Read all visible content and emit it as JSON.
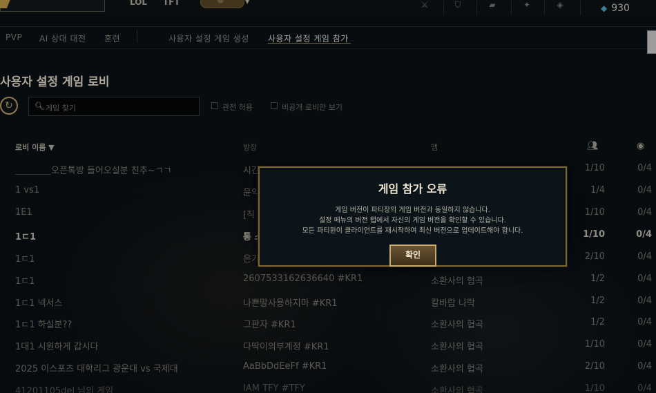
{
  "topbar": {
    "left_text_1": "LOL",
    "left_text_2": "TFT",
    "currency_value": "930"
  },
  "nav": {
    "pvp": "PVP",
    "ai": "AI 상대 대전",
    "training": "훈련",
    "custom_create": "사용자 설정 게임 생성",
    "custom_join": "사용자 설정 게임 참가"
  },
  "lobby": {
    "title": "사용자 설정 게임 로비",
    "search_placeholder": "게임 찾기",
    "allow_spectate": "관전 허용",
    "private_only": "비공개 로비만 보기"
  },
  "table": {
    "headers": {
      "lobby_name": "로비 이름 ▼",
      "owner": "방장",
      "map": "맵"
    },
    "rows": [
      {
        "name": "＿＿＿＿오픈톡방 들어오실분 친추~ㄱㄱ",
        "owner": "시간",
        "map": "",
        "players": "1/10",
        "spectators": "0/4"
      },
      {
        "name": "1 vs1",
        "owner": "윤익",
        "map": "",
        "players": "1/4",
        "spectators": "0/4"
      },
      {
        "name": "1E1",
        "owner": "[직",
        "map": "",
        "players": "1/10",
        "spectators": "0/4"
      },
      {
        "name": "1ㄷ1",
        "owner": "통 스",
        "map": "",
        "players": "1/10",
        "spectators": "0/4"
      },
      {
        "name": "1ㄷ1",
        "owner": "은가",
        "map": "",
        "players": "2/10",
        "spectators": "0/4"
      },
      {
        "name": "1ㄷ1",
        "owner": "2607533162636640 #KR1",
        "map": "소환사의 협곡",
        "players": "1/2",
        "spectators": "0/4"
      },
      {
        "name": "1ㄷ1 넥서스",
        "owner": "나쁜말사용하지마 #KR1",
        "map": "칼바람 나락",
        "players": "1/2",
        "spectators": "0/4"
      },
      {
        "name": "1ㄷ1 하실분??",
        "owner": "그판자 #KR1",
        "map": "소환사의 협곡",
        "players": "1/2",
        "spectators": "0/4"
      },
      {
        "name": "1대1 시원하게 갑시다",
        "owner": "다딱이의부계정 #KR1",
        "map": "소환사의 협곡",
        "players": "1/10",
        "spectators": "0/4"
      },
      {
        "name": "2025 이스포츠 대학리그 광운대 vs 국제대",
        "owner": "AaBbDdEeFf #KR1",
        "map": "소환사의 협곡",
        "players": "2/10",
        "spectators": "0/4"
      },
      {
        "name": "41201105del 님의 게임",
        "owner": "IAM TFY #TFY",
        "map": "소환사의 협곡",
        "players": "1/10",
        "spectators": "0/4"
      }
    ]
  },
  "modal": {
    "title": "게임 참가 오류",
    "line1": "게임 버전이 파티장의 게임 버전과 동일하지 않습니다.",
    "line2": "설정 메뉴의 버전 탭에서 자신의 게임 버전을 확인할 수 있습니다.",
    "line3": "모든 파티원이 클라이언트를 재시작하여 최신 버전으로 업데이트해야 합니다.",
    "confirm_label": "확인"
  },
  "colors": {
    "gold": "#c8aa6e",
    "teal": "#4db3c8",
    "bg": "#0a1016"
  },
  "icons": [
    "refresh-icon",
    "search-icon",
    "party-icon",
    "eye-icon",
    "rp-icon"
  ]
}
